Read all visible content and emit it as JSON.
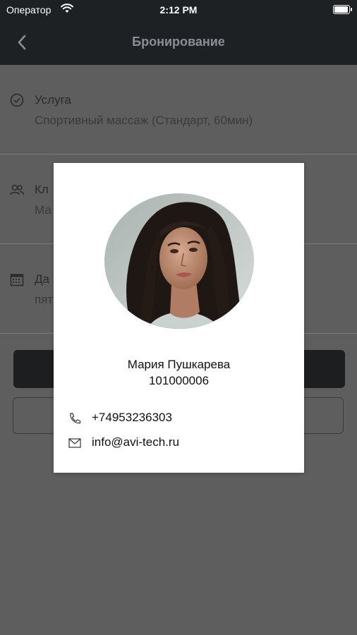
{
  "status_bar": {
    "carrier": "Оператор",
    "time": "2:12 PM"
  },
  "nav": {
    "title": "Бронирование",
    "back_icon": "chevron-left-icon"
  },
  "booking": {
    "service": {
      "label": "Услуга",
      "value": "Спортивный массаж (Стандарт, 60мин)",
      "icon": "check-circle-icon"
    },
    "client": {
      "label": "Кл",
      "value": "Ма",
      "icon": "users-icon"
    },
    "date": {
      "label": "Да",
      "value": "пят",
      "icon": "calendar-icon"
    }
  },
  "modal": {
    "name": "Мария Пушкарева",
    "code": "101000006",
    "phone": "+74953236303",
    "email": "info@avi-tech.ru",
    "phone_icon": "phone-icon",
    "email_icon": "mail-icon"
  },
  "colors": {
    "bar": "#1e2124",
    "overlay": "#5e5e5e",
    "modal_bg": "#ffffff"
  }
}
